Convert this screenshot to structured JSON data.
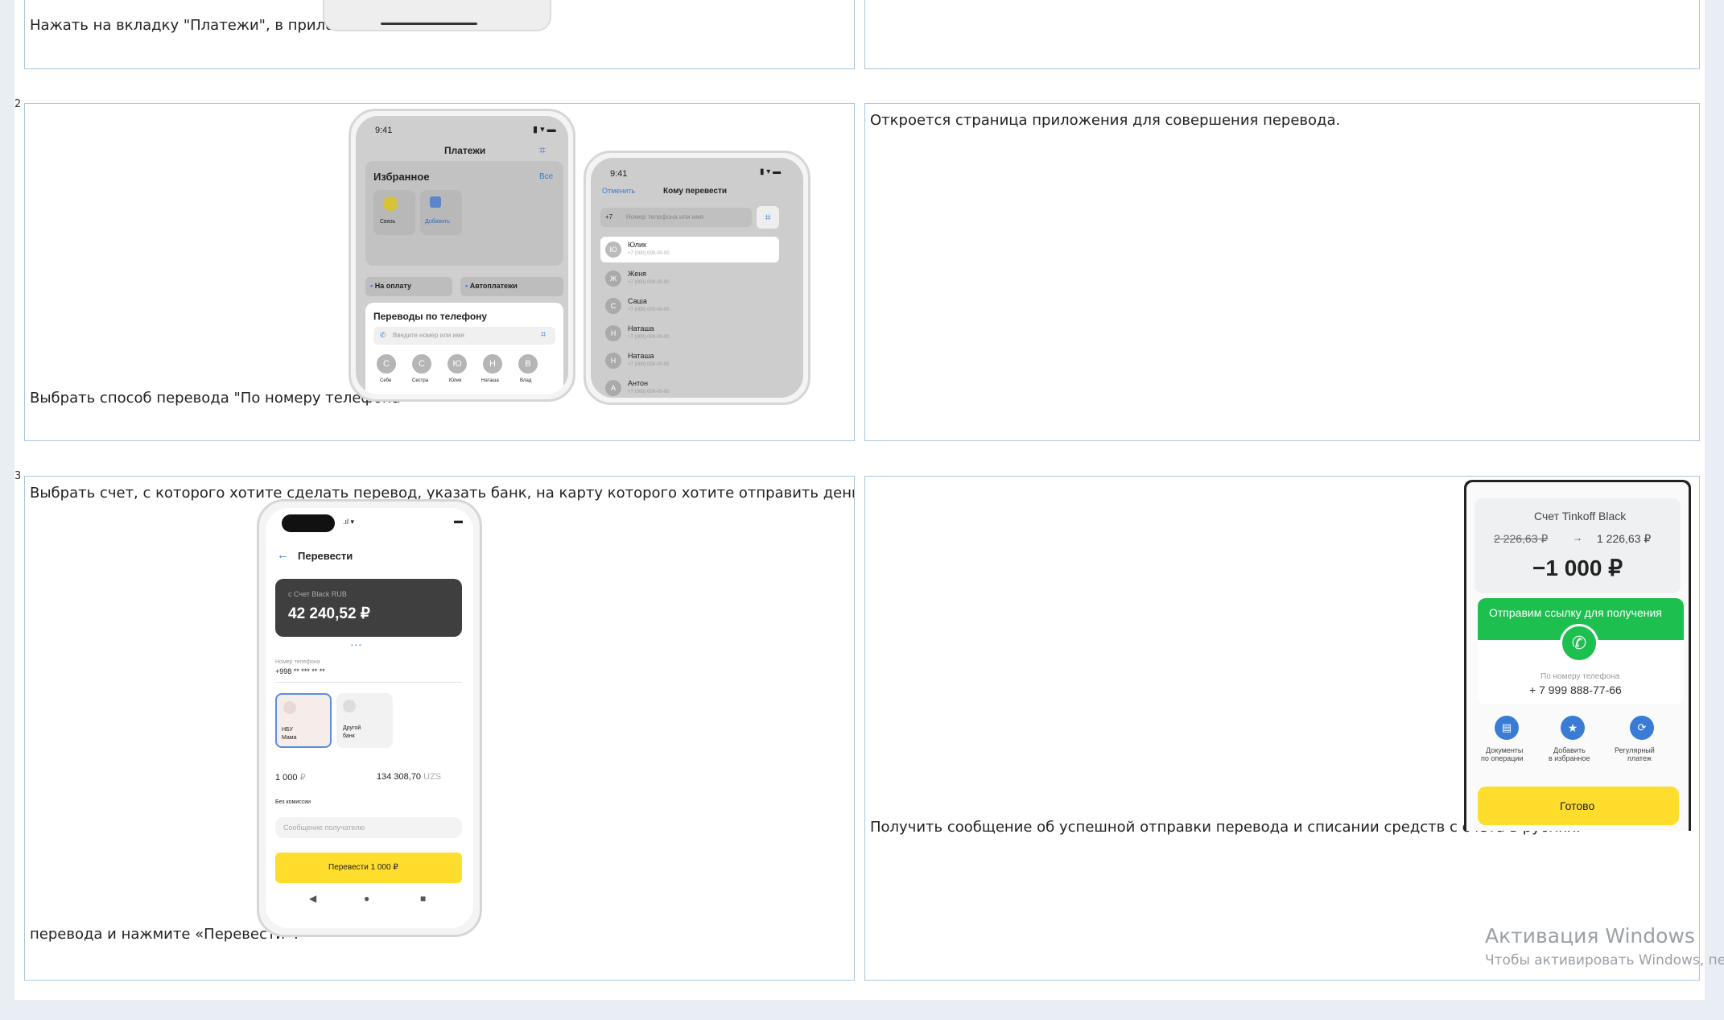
{
  "rows": {
    "row2_number": "2",
    "row3_number": "3"
  },
  "row1": {
    "left_text": "Нажать на вкладку \"Платежи\", в приложении."
  },
  "row2": {
    "left_text": "Выбрать способ перевода \"По номеру телефона\"",
    "right_text": "Откроется страница приложения для совершения перевода."
  },
  "row3": {
    "left_text_line1": "Выбрать счет, с которого хотите сделать перевод, указать банк, на карту которого хотите отправить деньги, ввести сумму",
    "left_text_line2": "перевода и нажмите «Перевести».",
    "right_text": "Получить сообщение об успешной отправки перевода и списании средств с счета в рублях."
  },
  "phone_payments": {
    "time": "9:41",
    "title": "Платежи",
    "favorites_title": "Избранное",
    "favorites_all": "Все",
    "fav1": "Связь",
    "fav2": "Добавить",
    "btn_pay": "На оплату",
    "btn_auto": "Автоплатежи",
    "transfers_title": "Переводы по телефону",
    "search_placeholder": "Введите номер или имя",
    "contacts": [
      {
        "initial": "С",
        "name": "Себе"
      },
      {
        "initial": "С",
        "name": "Сестра"
      },
      {
        "initial": "Ю",
        "name": "Юлик"
      },
      {
        "initial": "Н",
        "name": "Наташа"
      },
      {
        "initial": "В",
        "name": "Влад"
      }
    ]
  },
  "phone_recipient": {
    "time": "9:41",
    "cancel": "Отменить",
    "title": "Кому перевести",
    "prefix": "+7",
    "placeholder": "Номер телефона или имя",
    "contacts": [
      {
        "initial": "Ю",
        "name": "Юлик",
        "phone": "+7 (000) 000-00-00"
      },
      {
        "initial": "Ж",
        "name": "Женя",
        "phone": "+7 (000) 000-00-00"
      },
      {
        "initial": "С",
        "name": "Саша",
        "phone": "+7 (000) 000-00-00"
      },
      {
        "initial": "Н",
        "name": "Наташа",
        "phone": "+7 (000) 000-00-00"
      },
      {
        "initial": "Н",
        "name": "Наташа",
        "phone": "+7 (000) 000-00-00"
      },
      {
        "initial": "А",
        "name": "Антон",
        "phone": "+7 (000) 000-00-00"
      }
    ]
  },
  "phone_transfer": {
    "title": "Перевести",
    "account_label": "с Счет Black RUB",
    "balance": "42 240,52 ₽",
    "phone_label": "Номер телефона",
    "phone_value": "+998 ** *** ** **",
    "bank1_line1": "НБУ",
    "bank1_line2": "Мама",
    "bank2_line1": "Другой",
    "bank2_line2": "банк",
    "amount": "1 000",
    "amount_currency": "₽",
    "converted": "134 308,70",
    "converted_currency": "UZS",
    "fee": "Без комиссии",
    "message_placeholder": "Сообщение получателю",
    "button": "Перевести 1 000 ₽"
  },
  "phone_success": {
    "account": "Счет Tinkoff Black",
    "balance_old": "2 226,63 ₽",
    "balance_new": "1 226,63 ₽",
    "amount": "−1 000 ₽",
    "banner": "Отправим ссылку для получения",
    "by_phone_label": "По номеру телефона",
    "phone": "+ 7 999 888-77-66",
    "action1_line1": "Документы",
    "action1_line2": "по операции",
    "action2_line1": "Добавить",
    "action2_line2": "в избранное",
    "action3_line1": "Регулярный",
    "action3_line2": "платеж",
    "done": "Готово"
  },
  "watermark": {
    "title": "Активация Windows",
    "subtitle": "Чтобы активировать Windows, пере"
  },
  "colors": {
    "border": "#aac6dc",
    "accent_yellow": "#ffdd2d",
    "accent_green": "#1dbf4f",
    "accent_blue": "#3a7bd5"
  }
}
